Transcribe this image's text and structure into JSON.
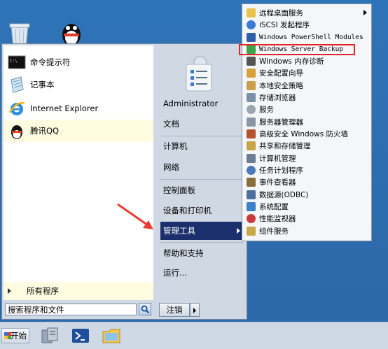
{
  "start_menu": {
    "pinned": [
      {
        "label": "命令提示符",
        "icon": "cmd-icon"
      },
      {
        "label": "记事本",
        "icon": "notepad-icon"
      },
      {
        "label": "Internet Explorer",
        "icon": "ie-icon"
      },
      {
        "label": "腾讯QQ",
        "icon": "qq-icon"
      }
    ],
    "all_programs": "所有程序",
    "search_placeholder": "搜索程序和文件",
    "right_items": {
      "administrator": "Administrator",
      "documents": "文档",
      "computer": "计算机",
      "network": "网络",
      "control_panel": "控制面板",
      "devices_printers": "设备和打印机",
      "admin_tools": "管理工具",
      "help": "帮助和支持",
      "run": "运行..."
    },
    "shutdown": "注销"
  },
  "admin_tools_submenu": [
    {
      "label": "远程桌面服务",
      "icon": "folder-icon",
      "color": "#e8c24a",
      "has_arrow": true
    },
    {
      "label": "iSCSI 发起程序",
      "icon": "iscsi-icon",
      "color": "#3b7bd4"
    },
    {
      "label": "Windows PowerShell Modules",
      "icon": "powershell-icon",
      "color": "#2f5fa8"
    },
    {
      "label": "Windows Server Backup",
      "icon": "backup-icon",
      "color": "#3fa34a",
      "highlighted": true
    },
    {
      "label": "Windows 内存诊断",
      "icon": "memory-icon",
      "color": "#555555"
    },
    {
      "label": "安全配置向导",
      "icon": "wizard-icon",
      "color": "#d8a23a"
    },
    {
      "label": "本地安全策略",
      "icon": "policy-icon",
      "color": "#c9a049"
    },
    {
      "label": "存储浏览器",
      "icon": "storage-icon",
      "color": "#7a8fa8"
    },
    {
      "label": "服务",
      "icon": "services-icon",
      "color": "#9aa5b1"
    },
    {
      "label": "服务器管理器",
      "icon": "server-manager-icon",
      "color": "#8896a6"
    },
    {
      "label": "高级安全 Windows 防火墙",
      "icon": "firewall-icon",
      "color": "#b5532d"
    },
    {
      "label": "共享和存储管理",
      "icon": "share-icon",
      "color": "#c7a34b"
    },
    {
      "label": "计算机管理",
      "icon": "computer-management-icon",
      "color": "#6a7d95"
    },
    {
      "label": "任务计划程序",
      "icon": "clock-icon",
      "color": "#4a78b8"
    },
    {
      "label": "事件查看器",
      "icon": "event-viewer-icon",
      "color": "#8a6d3b"
    },
    {
      "label": "数据源(ODBC)",
      "icon": "odbc-icon",
      "color": "#4f6fa0"
    },
    {
      "label": "系统配置",
      "icon": "msconfig-icon",
      "color": "#3d82c8"
    },
    {
      "label": "性能监视器",
      "icon": "perfmon-icon",
      "color": "#c93a3a"
    },
    {
      "label": "组件服务",
      "icon": "component-icon",
      "color": "#c9a84a"
    }
  ],
  "taskbar": {
    "start_label": "开始"
  },
  "colors": {
    "selection": "#1a2f6b",
    "highlight_box": "#e4222a",
    "arrow": "#ee3b2f"
  }
}
